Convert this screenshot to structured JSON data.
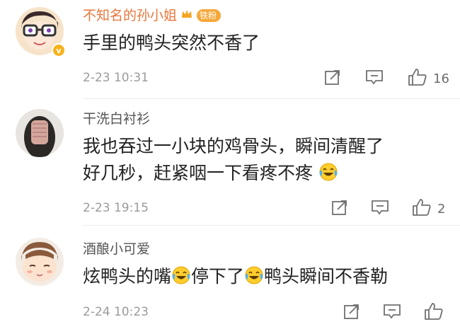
{
  "comments": [
    {
      "username": "不知名的孙小姐",
      "fan_badge": "铁粉",
      "vip_label": "v",
      "text_lines": [
        "手里的鸭头突然不香了"
      ],
      "time": "2-23 10:31",
      "likes": "16"
    },
    {
      "username": "干洗白衬衫",
      "text_lines": [
        "我也吞过一小块的鸡骨头，瞬间清醒了",
        "好几秒，赶紧咽一下看疼不疼"
      ],
      "time": "2-23 19:15",
      "likes": "2"
    },
    {
      "username": "酒酿小可爱",
      "text_parts": [
        "炫鸭头的嘴",
        "停下了",
        "鸭头瞬间不香勒"
      ],
      "time": "2-24 10:23",
      "likes": ""
    }
  ],
  "icons": {
    "share": "share-icon",
    "comment": "comment-icon",
    "like": "thumbs-up-icon",
    "emoji": "laughing-tears-emoji",
    "crown": "crown-icon"
  },
  "colors": {
    "username_highlight": "#e8763a",
    "fan_badge": "#f5a83a",
    "meta": "#9b9b9b"
  }
}
